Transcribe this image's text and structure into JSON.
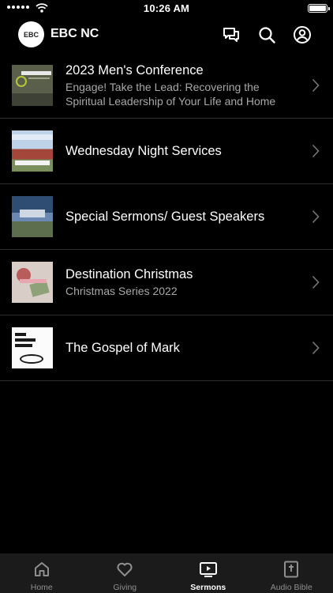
{
  "status_bar": {
    "time": "10:26 AM"
  },
  "header": {
    "logo_text": "EBC",
    "app_name": "EBC NC",
    "icons": [
      "chat-icon",
      "search-icon",
      "account-icon"
    ]
  },
  "sermon_series": [
    {
      "title": "2023 Men's Conference",
      "subtitle": "Engage! Take the Lead: Recovering the Spiritual Leadership of Your Life and Home"
    },
    {
      "title": "Wednesday Night Services",
      "subtitle": ""
    },
    {
      "title": "Special Sermons/ Guest Speakers",
      "subtitle": ""
    },
    {
      "title": "Destination Christmas",
      "subtitle": "Christmas Series 2022"
    },
    {
      "title": "The Gospel of Mark",
      "subtitle": ""
    }
  ],
  "tab_bar": {
    "tabs": [
      {
        "label": "Home",
        "icon": "home-icon"
      },
      {
        "label": "Giving",
        "icon": "heart-icon"
      },
      {
        "label": "Sermons",
        "icon": "tv-play-icon",
        "active": true
      },
      {
        "label": "Audio Bible",
        "icon": "bible-icon"
      }
    ]
  },
  "colors": {
    "background": "#000000",
    "tab_bar": "#1b1b1b",
    "subtitle": "#a8a8a8",
    "divider": "#2c2c2c"
  }
}
